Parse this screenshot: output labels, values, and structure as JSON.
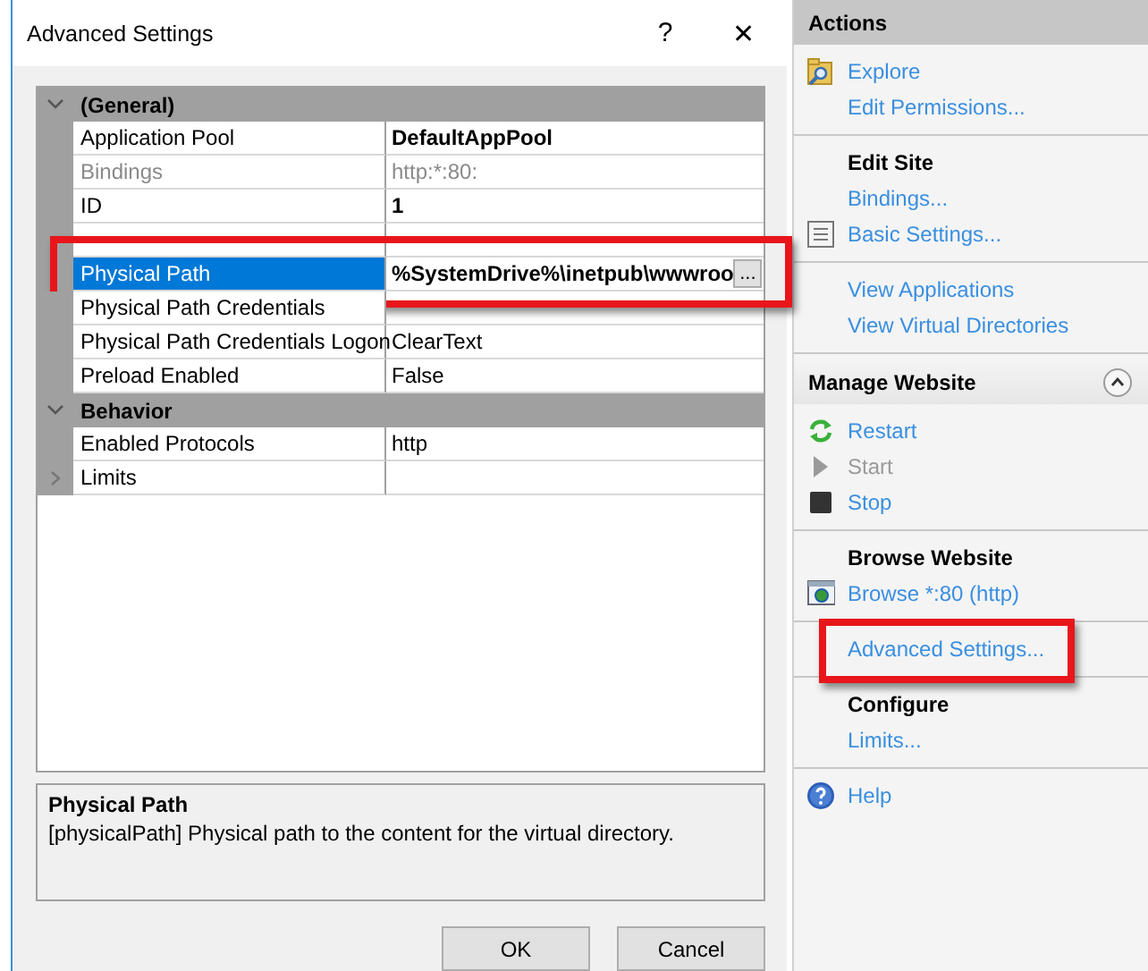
{
  "dialog": {
    "title": "Advanced Settings",
    "help_glyph": "?",
    "close_glyph": "✕",
    "categories": [
      {
        "label": "(General)",
        "expanded": true,
        "properties": [
          {
            "name": "Application Pool",
            "value": "DefaultAppPool",
            "bold": true,
            "disabled": false,
            "selected": false
          },
          {
            "name": "Bindings",
            "value": "http:*:80:",
            "bold": false,
            "disabled": true,
            "selected": false
          },
          {
            "name": "ID",
            "value": "1",
            "bold": true,
            "disabled": false,
            "selected": false
          },
          {
            "selected": false
          },
          {
            "name": "Physical Path",
            "value": "%SystemDrive%\\inetpub\\wwwroo",
            "bold": true,
            "disabled": false,
            "selected": true,
            "highlighted": true,
            "browse": "..."
          },
          {
            "name": "Physical Path Credentials",
            "disabled": false,
            "selected": false
          },
          {
            "name": "Physical Path Credentials Logon",
            "value": "ClearText",
            "bold": false,
            "disabled": false,
            "selected": false
          },
          {
            "name": "Preload Enabled",
            "value": "False",
            "bold": false,
            "disabled": false,
            "selected": false
          }
        ]
      },
      {
        "label": "Behavior",
        "expanded": true,
        "properties": [
          {
            "name": "Enabled Protocols",
            "value": "http",
            "bold": false,
            "disabled": false,
            "selected": false
          },
          {
            "name": "Limits",
            "disabled": false,
            "selected": false,
            "expandable": true
          }
        ]
      }
    ],
    "description": {
      "title": "Physical Path",
      "text": "[physicalPath] Physical path to the content for the virtual directory."
    },
    "buttons": [
      "OK",
      "Cancel"
    ]
  },
  "actions": {
    "title": "Actions",
    "sections": [
      {
        "groups": [
          {
            "items": [
              {
                "kind": "link",
                "label": "Explore",
                "disabled": false,
                "highlighted": false
              },
              {
                "kind": "link",
                "label": "Edit Permissions...",
                "disabled": false,
                "highlighted": false
              }
            ]
          },
          {
            "items": [
              {
                "kind": "heading",
                "label": "Edit Site"
              },
              {
                "kind": "link",
                "label": "Bindings...",
                "disabled": false,
                "highlighted": false
              },
              {
                "kind": "link",
                "label": "Basic Settings...",
                "disabled": false,
                "highlighted": false
              }
            ]
          },
          {
            "items": [
              {
                "kind": "link",
                "label": "View Applications",
                "disabled": false,
                "highlighted": false
              },
              {
                "kind": "link",
                "label": "View Virtual Directories",
                "disabled": false,
                "highlighted": false
              }
            ]
          }
        ]
      },
      {
        "title": "Manage Website",
        "expanded": true,
        "groups": [
          {
            "items": [
              {
                "kind": "link",
                "label": "Restart",
                "disabled": false,
                "highlighted": false
              },
              {
                "kind": "link",
                "label": "Start",
                "disabled": true,
                "highlighted": false
              },
              {
                "kind": "link",
                "label": "Stop",
                "disabled": false,
                "highlighted": false
              }
            ]
          },
          {
            "items": [
              {
                "kind": "heading",
                "label": "Browse Website"
              },
              {
                "kind": "link",
                "label": "Browse *:80 (http)",
                "disabled": false,
                "highlighted": false
              }
            ]
          },
          {
            "items": [
              {
                "kind": "link",
                "label": "Advanced Settings...",
                "disabled": false,
                "highlighted": true
              }
            ]
          },
          {
            "items": [
              {
                "kind": "heading",
                "label": "Configure"
              },
              {
                "kind": "link",
                "label": "Limits...",
                "disabled": false,
                "highlighted": false
              }
            ]
          },
          {
            "items": [
              {
                "kind": "link",
                "label": "Help",
                "disabled": false,
                "highlighted": false
              }
            ]
          }
        ]
      }
    ]
  }
}
